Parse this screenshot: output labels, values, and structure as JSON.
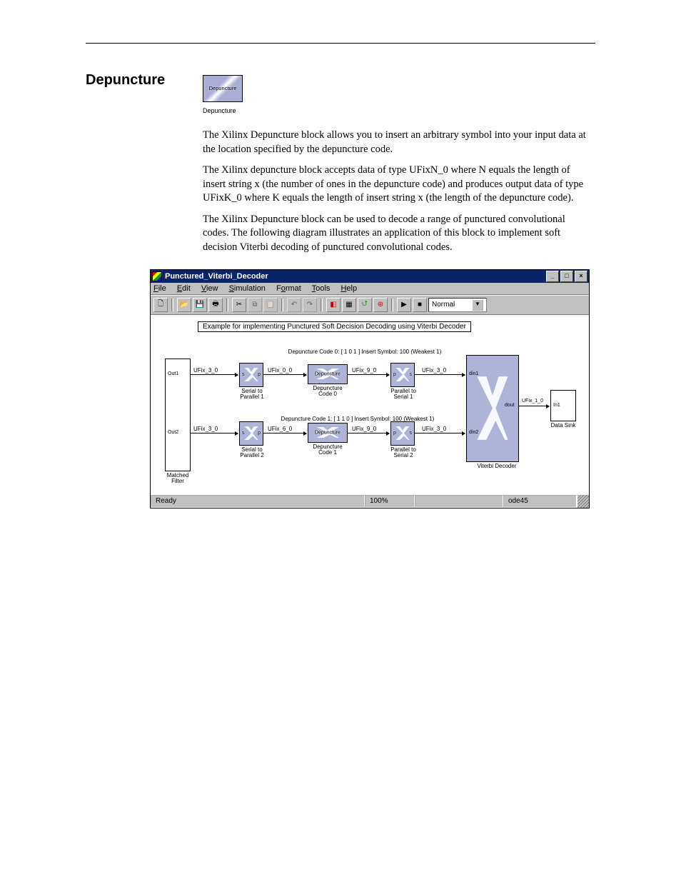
{
  "page": {
    "header": ""
  },
  "section": {
    "title": "Depuncture",
    "desc": "The Xilinx Depuncture block allows you to insert an arbitrary symbol into your input data at the location specified by the depuncture code.",
    "block_text": "Depuncture",
    "block_caption": "Depuncture",
    "para2": "The Xilinx depuncture block accepts data of type UFixN_0 where N equals the length of insert string x (the number of ones in the depuncture code) and produces output data of type UFixK_0 where K equals the length of insert string x (the length of the depuncture code).",
    "para3": "The Xilinx Depuncture block can be used to decode a range of punctured convolutional codes. The following diagram illustrates an application of this block to implement soft decision Viterbi decoding of punctured convolutional codes."
  },
  "window": {
    "title": "Punctured_Viterbi_Decoder",
    "menus": [
      "File",
      "Edit",
      "View",
      "Simulation",
      "Format",
      "Tools",
      "Help"
    ],
    "mode": "Normal",
    "example_box": "Example for implementing Punctured Soft Decision Decoding using Viterbi Decoder",
    "ann0": "Depuncture Code 0: [ 1 0 1 ]   Insert Symbol: 100 (Weakest 1)",
    "ann1": "Depuncture Code 1: [ 1 1 0 ]   Insert Symbol: 100 (Weakest 1)",
    "labels": {
      "out1": "Out1",
      "out2": "Out2",
      "ufix30": "UFix_3_0",
      "ufix00": "UFix_0_0",
      "ufix60": "UFix_6_0",
      "ufix90": "UFix_9_0",
      "ufix10": "UFix_1_0",
      "matched_filter": "Matched\nFilter",
      "sp1": "Serial to\nParallel 1",
      "sp2": "Serial to\nParallel 2",
      "dep0": "Depuncture\nCode 0",
      "dep1": "Depuncture\nCode 1",
      "ps1": "Parallel to\nSerial 1",
      "ps2": "Parallel to\nSerial 2",
      "viterbi": "Viterbi Decoder",
      "sink": "Data Sink",
      "din1": "din1",
      "din2": "din2",
      "dout": "dout",
      "in1": "In1",
      "s": "s",
      "p": "p",
      "dep": "Depuncture"
    },
    "status": {
      "ready": "Ready",
      "zoom": "100%",
      "solver": "ode45"
    }
  }
}
